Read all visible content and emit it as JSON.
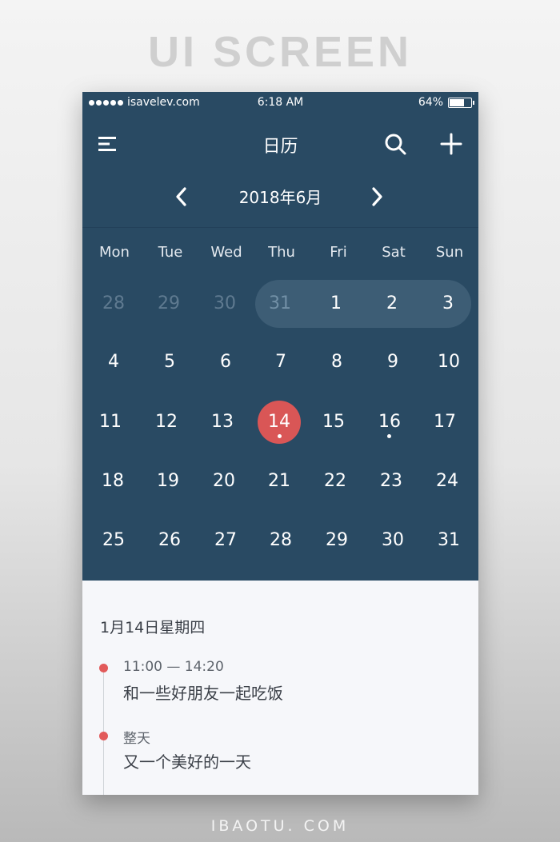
{
  "banner": {
    "title": "UI SCREEN"
  },
  "status_bar": {
    "carrier": "isavelev.com",
    "time": "6:18 AM",
    "battery": "64%",
    "battery_level": 0.64
  },
  "nav": {
    "title": "日历",
    "menu_icon": "menu-icon",
    "search_icon": "search-icon",
    "add_icon": "plus-icon"
  },
  "month_nav": {
    "label": "2018年6月",
    "prev_icon": "chevron-left-icon",
    "next_icon": "chevron-right-icon"
  },
  "weekdays": [
    "Mon",
    "Tue",
    "Wed",
    "Thu",
    "Fri",
    "Sat",
    "Sun"
  ],
  "weeks": [
    [
      "28",
      "29",
      "30",
      "31",
      "1",
      "2",
      "3"
    ],
    [
      "4",
      "5",
      "6",
      "7",
      "8",
      "9",
      "10"
    ],
    [
      "11",
      "12",
      "13",
      "14",
      "15",
      "16",
      "17"
    ],
    [
      "18",
      "19",
      "20",
      "21",
      "22",
      "23",
      "24"
    ],
    [
      "25",
      "26",
      "27",
      "28",
      "29",
      "30",
      "31"
    ]
  ],
  "selected_day": "14",
  "event_days": [
    "14",
    "16"
  ],
  "agenda": {
    "date_label": "1月14日星期四",
    "events": [
      {
        "time": "11:00 — 14:20",
        "title": "和一些好朋友一起吃饭"
      },
      {
        "time": "整天",
        "title": "又一个美好的一天"
      }
    ]
  },
  "colors": {
    "header_bg": "#294a63",
    "accent": "#d95656",
    "agenda_bg": "#f6f7fa"
  },
  "footer": {
    "brand": "IBAOTU. COM"
  }
}
